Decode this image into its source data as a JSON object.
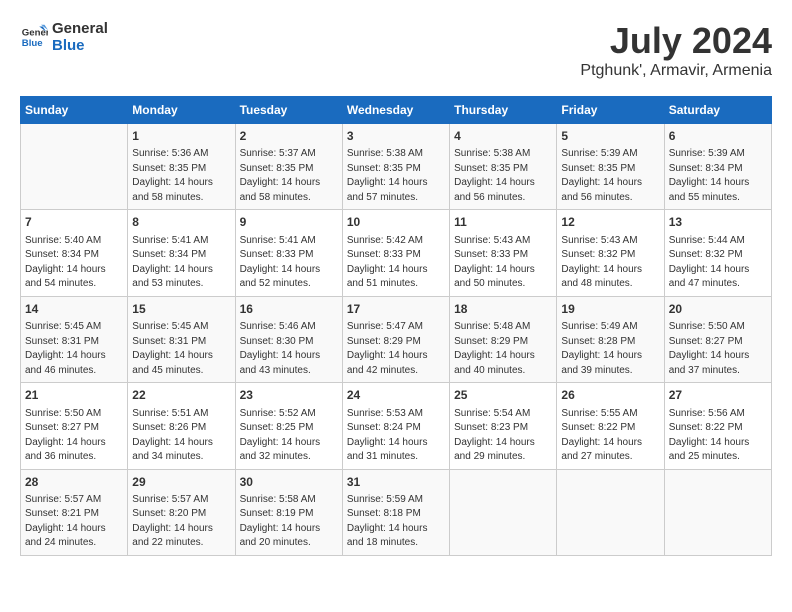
{
  "logo": {
    "line1": "General",
    "line2": "Blue"
  },
  "title": "July 2024",
  "subtitle": "Ptghunk', Armavir, Armenia",
  "weekdays": [
    "Sunday",
    "Monday",
    "Tuesday",
    "Wednesday",
    "Thursday",
    "Friday",
    "Saturday"
  ],
  "weeks": [
    [
      {
        "day": "",
        "info": ""
      },
      {
        "day": "1",
        "info": "Sunrise: 5:36 AM\nSunset: 8:35 PM\nDaylight: 14 hours\nand 58 minutes."
      },
      {
        "day": "2",
        "info": "Sunrise: 5:37 AM\nSunset: 8:35 PM\nDaylight: 14 hours\nand 58 minutes."
      },
      {
        "day": "3",
        "info": "Sunrise: 5:38 AM\nSunset: 8:35 PM\nDaylight: 14 hours\nand 57 minutes."
      },
      {
        "day": "4",
        "info": "Sunrise: 5:38 AM\nSunset: 8:35 PM\nDaylight: 14 hours\nand 56 minutes."
      },
      {
        "day": "5",
        "info": "Sunrise: 5:39 AM\nSunset: 8:35 PM\nDaylight: 14 hours\nand 56 minutes."
      },
      {
        "day": "6",
        "info": "Sunrise: 5:39 AM\nSunset: 8:34 PM\nDaylight: 14 hours\nand 55 minutes."
      }
    ],
    [
      {
        "day": "7",
        "info": "Sunrise: 5:40 AM\nSunset: 8:34 PM\nDaylight: 14 hours\nand 54 minutes."
      },
      {
        "day": "8",
        "info": "Sunrise: 5:41 AM\nSunset: 8:34 PM\nDaylight: 14 hours\nand 53 minutes."
      },
      {
        "day": "9",
        "info": "Sunrise: 5:41 AM\nSunset: 8:33 PM\nDaylight: 14 hours\nand 52 minutes."
      },
      {
        "day": "10",
        "info": "Sunrise: 5:42 AM\nSunset: 8:33 PM\nDaylight: 14 hours\nand 51 minutes."
      },
      {
        "day": "11",
        "info": "Sunrise: 5:43 AM\nSunset: 8:33 PM\nDaylight: 14 hours\nand 50 minutes."
      },
      {
        "day": "12",
        "info": "Sunrise: 5:43 AM\nSunset: 8:32 PM\nDaylight: 14 hours\nand 48 minutes."
      },
      {
        "day": "13",
        "info": "Sunrise: 5:44 AM\nSunset: 8:32 PM\nDaylight: 14 hours\nand 47 minutes."
      }
    ],
    [
      {
        "day": "14",
        "info": "Sunrise: 5:45 AM\nSunset: 8:31 PM\nDaylight: 14 hours\nand 46 minutes."
      },
      {
        "day": "15",
        "info": "Sunrise: 5:45 AM\nSunset: 8:31 PM\nDaylight: 14 hours\nand 45 minutes."
      },
      {
        "day": "16",
        "info": "Sunrise: 5:46 AM\nSunset: 8:30 PM\nDaylight: 14 hours\nand 43 minutes."
      },
      {
        "day": "17",
        "info": "Sunrise: 5:47 AM\nSunset: 8:29 PM\nDaylight: 14 hours\nand 42 minutes."
      },
      {
        "day": "18",
        "info": "Sunrise: 5:48 AM\nSunset: 8:29 PM\nDaylight: 14 hours\nand 40 minutes."
      },
      {
        "day": "19",
        "info": "Sunrise: 5:49 AM\nSunset: 8:28 PM\nDaylight: 14 hours\nand 39 minutes."
      },
      {
        "day": "20",
        "info": "Sunrise: 5:50 AM\nSunset: 8:27 PM\nDaylight: 14 hours\nand 37 minutes."
      }
    ],
    [
      {
        "day": "21",
        "info": "Sunrise: 5:50 AM\nSunset: 8:27 PM\nDaylight: 14 hours\nand 36 minutes."
      },
      {
        "day": "22",
        "info": "Sunrise: 5:51 AM\nSunset: 8:26 PM\nDaylight: 14 hours\nand 34 minutes."
      },
      {
        "day": "23",
        "info": "Sunrise: 5:52 AM\nSunset: 8:25 PM\nDaylight: 14 hours\nand 32 minutes."
      },
      {
        "day": "24",
        "info": "Sunrise: 5:53 AM\nSunset: 8:24 PM\nDaylight: 14 hours\nand 31 minutes."
      },
      {
        "day": "25",
        "info": "Sunrise: 5:54 AM\nSunset: 8:23 PM\nDaylight: 14 hours\nand 29 minutes."
      },
      {
        "day": "26",
        "info": "Sunrise: 5:55 AM\nSunset: 8:22 PM\nDaylight: 14 hours\nand 27 minutes."
      },
      {
        "day": "27",
        "info": "Sunrise: 5:56 AM\nSunset: 8:22 PM\nDaylight: 14 hours\nand 25 minutes."
      }
    ],
    [
      {
        "day": "28",
        "info": "Sunrise: 5:57 AM\nSunset: 8:21 PM\nDaylight: 14 hours\nand 24 minutes."
      },
      {
        "day": "29",
        "info": "Sunrise: 5:57 AM\nSunset: 8:20 PM\nDaylight: 14 hours\nand 22 minutes."
      },
      {
        "day": "30",
        "info": "Sunrise: 5:58 AM\nSunset: 8:19 PM\nDaylight: 14 hours\nand 20 minutes."
      },
      {
        "day": "31",
        "info": "Sunrise: 5:59 AM\nSunset: 8:18 PM\nDaylight: 14 hours\nand 18 minutes."
      },
      {
        "day": "",
        "info": ""
      },
      {
        "day": "",
        "info": ""
      },
      {
        "day": "",
        "info": ""
      }
    ]
  ]
}
